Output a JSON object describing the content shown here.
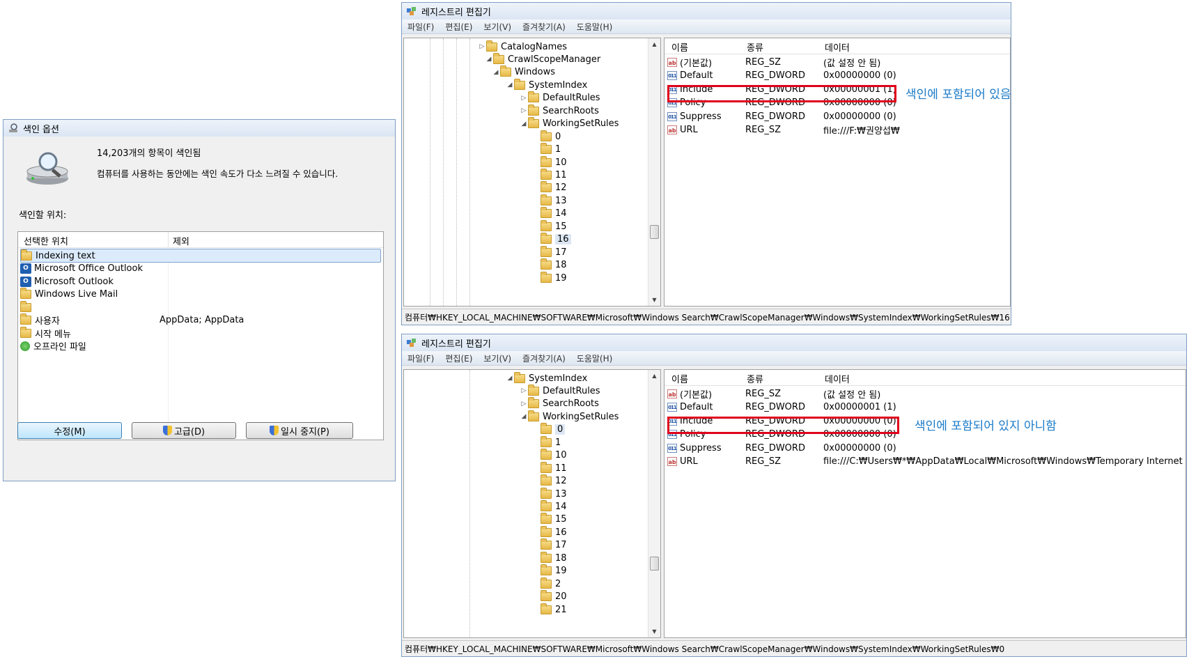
{
  "indexing_options": {
    "title": "색인 옵션",
    "indexed_count_text": "14,203개의 항목이 색인됨",
    "speed_notice": "컴퓨터를 사용하는 동안에는 색인 속도가 다소 느려질 수 있습니다.",
    "locations_label": "색인할 위치:",
    "col_selected": "선택한 위치",
    "col_exclude": "제외",
    "locations": [
      {
        "icon": "folder-icon",
        "name": "Indexing text",
        "exclude": ""
      },
      {
        "icon": "outlook-icon",
        "name": "Microsoft Office Outlook",
        "exclude": ""
      },
      {
        "icon": "outlook-icon",
        "name": "Microsoft Outlook",
        "exclude": ""
      },
      {
        "icon": "folder-icon",
        "name": "Windows Live Mail",
        "exclude": ""
      },
      {
        "icon": "folder-icon",
        "name": "",
        "exclude": ""
      },
      {
        "icon": "folder-icon",
        "name": "사용자",
        "exclude": "AppData; AppData"
      },
      {
        "icon": "folder-icon",
        "name": "시작 메뉴",
        "exclude": ""
      },
      {
        "icon": "offline-files-icon",
        "name": "오프라인 파일",
        "exclude": ""
      }
    ],
    "btn_modify": "수정(M)",
    "btn_advanced": "고급(D)",
    "btn_pause": "일시 중지(P)"
  },
  "regedit_top": {
    "title": "레지스트리 편집기",
    "menu": [
      "파일(F)",
      "편집(E)",
      "보기(V)",
      "즐겨찾기(A)",
      "도움말(H)"
    ],
    "tree": [
      {
        "label": "CatalogNames",
        "arrow": "▷"
      },
      {
        "label": "CrawlScopeManager",
        "arrow": "◢"
      },
      {
        "label": "Windows",
        "arrow": "◢"
      },
      {
        "label": "SystemIndex",
        "arrow": "◢"
      },
      {
        "label": "DefaultRules",
        "arrow": "▷"
      },
      {
        "label": "SearchRoots",
        "arrow": "▷"
      },
      {
        "label": "WorkingSetRules",
        "arrow": "◢"
      },
      {
        "label": "0",
        "arrow": ""
      },
      {
        "label": "1",
        "arrow": ""
      },
      {
        "label": "10",
        "arrow": ""
      },
      {
        "label": "11",
        "arrow": ""
      },
      {
        "label": "12",
        "arrow": ""
      },
      {
        "label": "13",
        "arrow": ""
      },
      {
        "label": "14",
        "arrow": ""
      },
      {
        "label": "15",
        "arrow": ""
      },
      {
        "label": "16",
        "arrow": ""
      },
      {
        "label": "17",
        "arrow": ""
      },
      {
        "label": "18",
        "arrow": ""
      },
      {
        "label": "19",
        "arrow": ""
      }
    ],
    "selected_tree_item": "16",
    "col_name": "이름",
    "col_type": "종류",
    "col_data": "데이터",
    "values": [
      {
        "icon": "ab-string-icon",
        "name": "(기본값)",
        "type": "REG_SZ",
        "data": "(값 설정 안 됨)"
      },
      {
        "icon": "binary-dword-icon",
        "name": "Default",
        "type": "REG_DWORD",
        "data": "0x00000000 (0)"
      },
      {
        "icon": "binary-dword-icon",
        "name": "Include",
        "type": "REG_DWORD",
        "data": "0x00000001 (1)"
      },
      {
        "icon": "binary-dword-icon",
        "name": "Policy",
        "type": "REG_DWORD",
        "data": "0x00000000 (0)"
      },
      {
        "icon": "binary-dword-icon",
        "name": "Suppress",
        "type": "REG_DWORD",
        "data": "0x00000000 (0)"
      },
      {
        "icon": "ab-string-icon",
        "name": "URL",
        "type": "REG_SZ",
        "data": "file:///F:₩권양섭₩"
      }
    ],
    "status": "컴퓨터₩HKEY_LOCAL_MACHINE₩SOFTWARE₩Microsoft₩Windows Search₩CrawlScopeManager₩Windows₩SystemIndex₩WorkingSetRules₩16",
    "annotation": "색인에 포함되어 있음"
  },
  "regedit_bottom": {
    "title": "레지스트리 편집기",
    "menu": [
      "파일(F)",
      "편집(E)",
      "보기(V)",
      "즐겨찾기(A)",
      "도움말(H)"
    ],
    "tree": [
      {
        "label": "SystemIndex",
        "arrow": "◢"
      },
      {
        "label": "DefaultRules",
        "arrow": "▷"
      },
      {
        "label": "SearchRoots",
        "arrow": "▷"
      },
      {
        "label": "WorkingSetRules",
        "arrow": "◢"
      },
      {
        "label": "0",
        "arrow": ""
      },
      {
        "label": "1",
        "arrow": ""
      },
      {
        "label": "10",
        "arrow": ""
      },
      {
        "label": "11",
        "arrow": ""
      },
      {
        "label": "12",
        "arrow": ""
      },
      {
        "label": "13",
        "arrow": ""
      },
      {
        "label": "14",
        "arrow": ""
      },
      {
        "label": "15",
        "arrow": ""
      },
      {
        "label": "16",
        "arrow": ""
      },
      {
        "label": "17",
        "arrow": ""
      },
      {
        "label": "18",
        "arrow": ""
      },
      {
        "label": "19",
        "arrow": ""
      },
      {
        "label": "2",
        "arrow": ""
      },
      {
        "label": "20",
        "arrow": ""
      },
      {
        "label": "21",
        "arrow": ""
      }
    ],
    "selected_tree_item": "0",
    "col_name": "이름",
    "col_type": "종류",
    "col_data": "데이터",
    "values": [
      {
        "icon": "ab-string-icon",
        "name": "(기본값)",
        "type": "REG_SZ",
        "data": "(값 설정 안 됨)"
      },
      {
        "icon": "binary-dword-icon",
        "name": "Default",
        "type": "REG_DWORD",
        "data": "0x00000001 (1)"
      },
      {
        "icon": "binary-dword-icon",
        "name": "Include",
        "type": "REG_DWORD",
        "data": "0x00000000 (0)"
      },
      {
        "icon": "binary-dword-icon",
        "name": "Policy",
        "type": "REG_DWORD",
        "data": "0x00000000 (0)"
      },
      {
        "icon": "binary-dword-icon",
        "name": "Suppress",
        "type": "REG_DWORD",
        "data": "0x00000000 (0)"
      },
      {
        "icon": "ab-string-icon",
        "name": "URL",
        "type": "REG_SZ",
        "data": "file:///C:₩Users₩*₩AppData₩Local₩Microsoft₩Windows₩Temporary Internet Files₩*"
      }
    ],
    "status": "컴퓨터₩HKEY_LOCAL_MACHINE₩SOFTWARE₩Microsoft₩Windows Search₩CrawlScopeManager₩Windows₩SystemIndex₩WorkingSetRules₩0",
    "annotation": "색인에 포함되어 있지 아니함"
  },
  "colors": {
    "highlight_box": "#e0001b",
    "annotation": "#1b7bc8",
    "selection": "#cce4f7"
  }
}
